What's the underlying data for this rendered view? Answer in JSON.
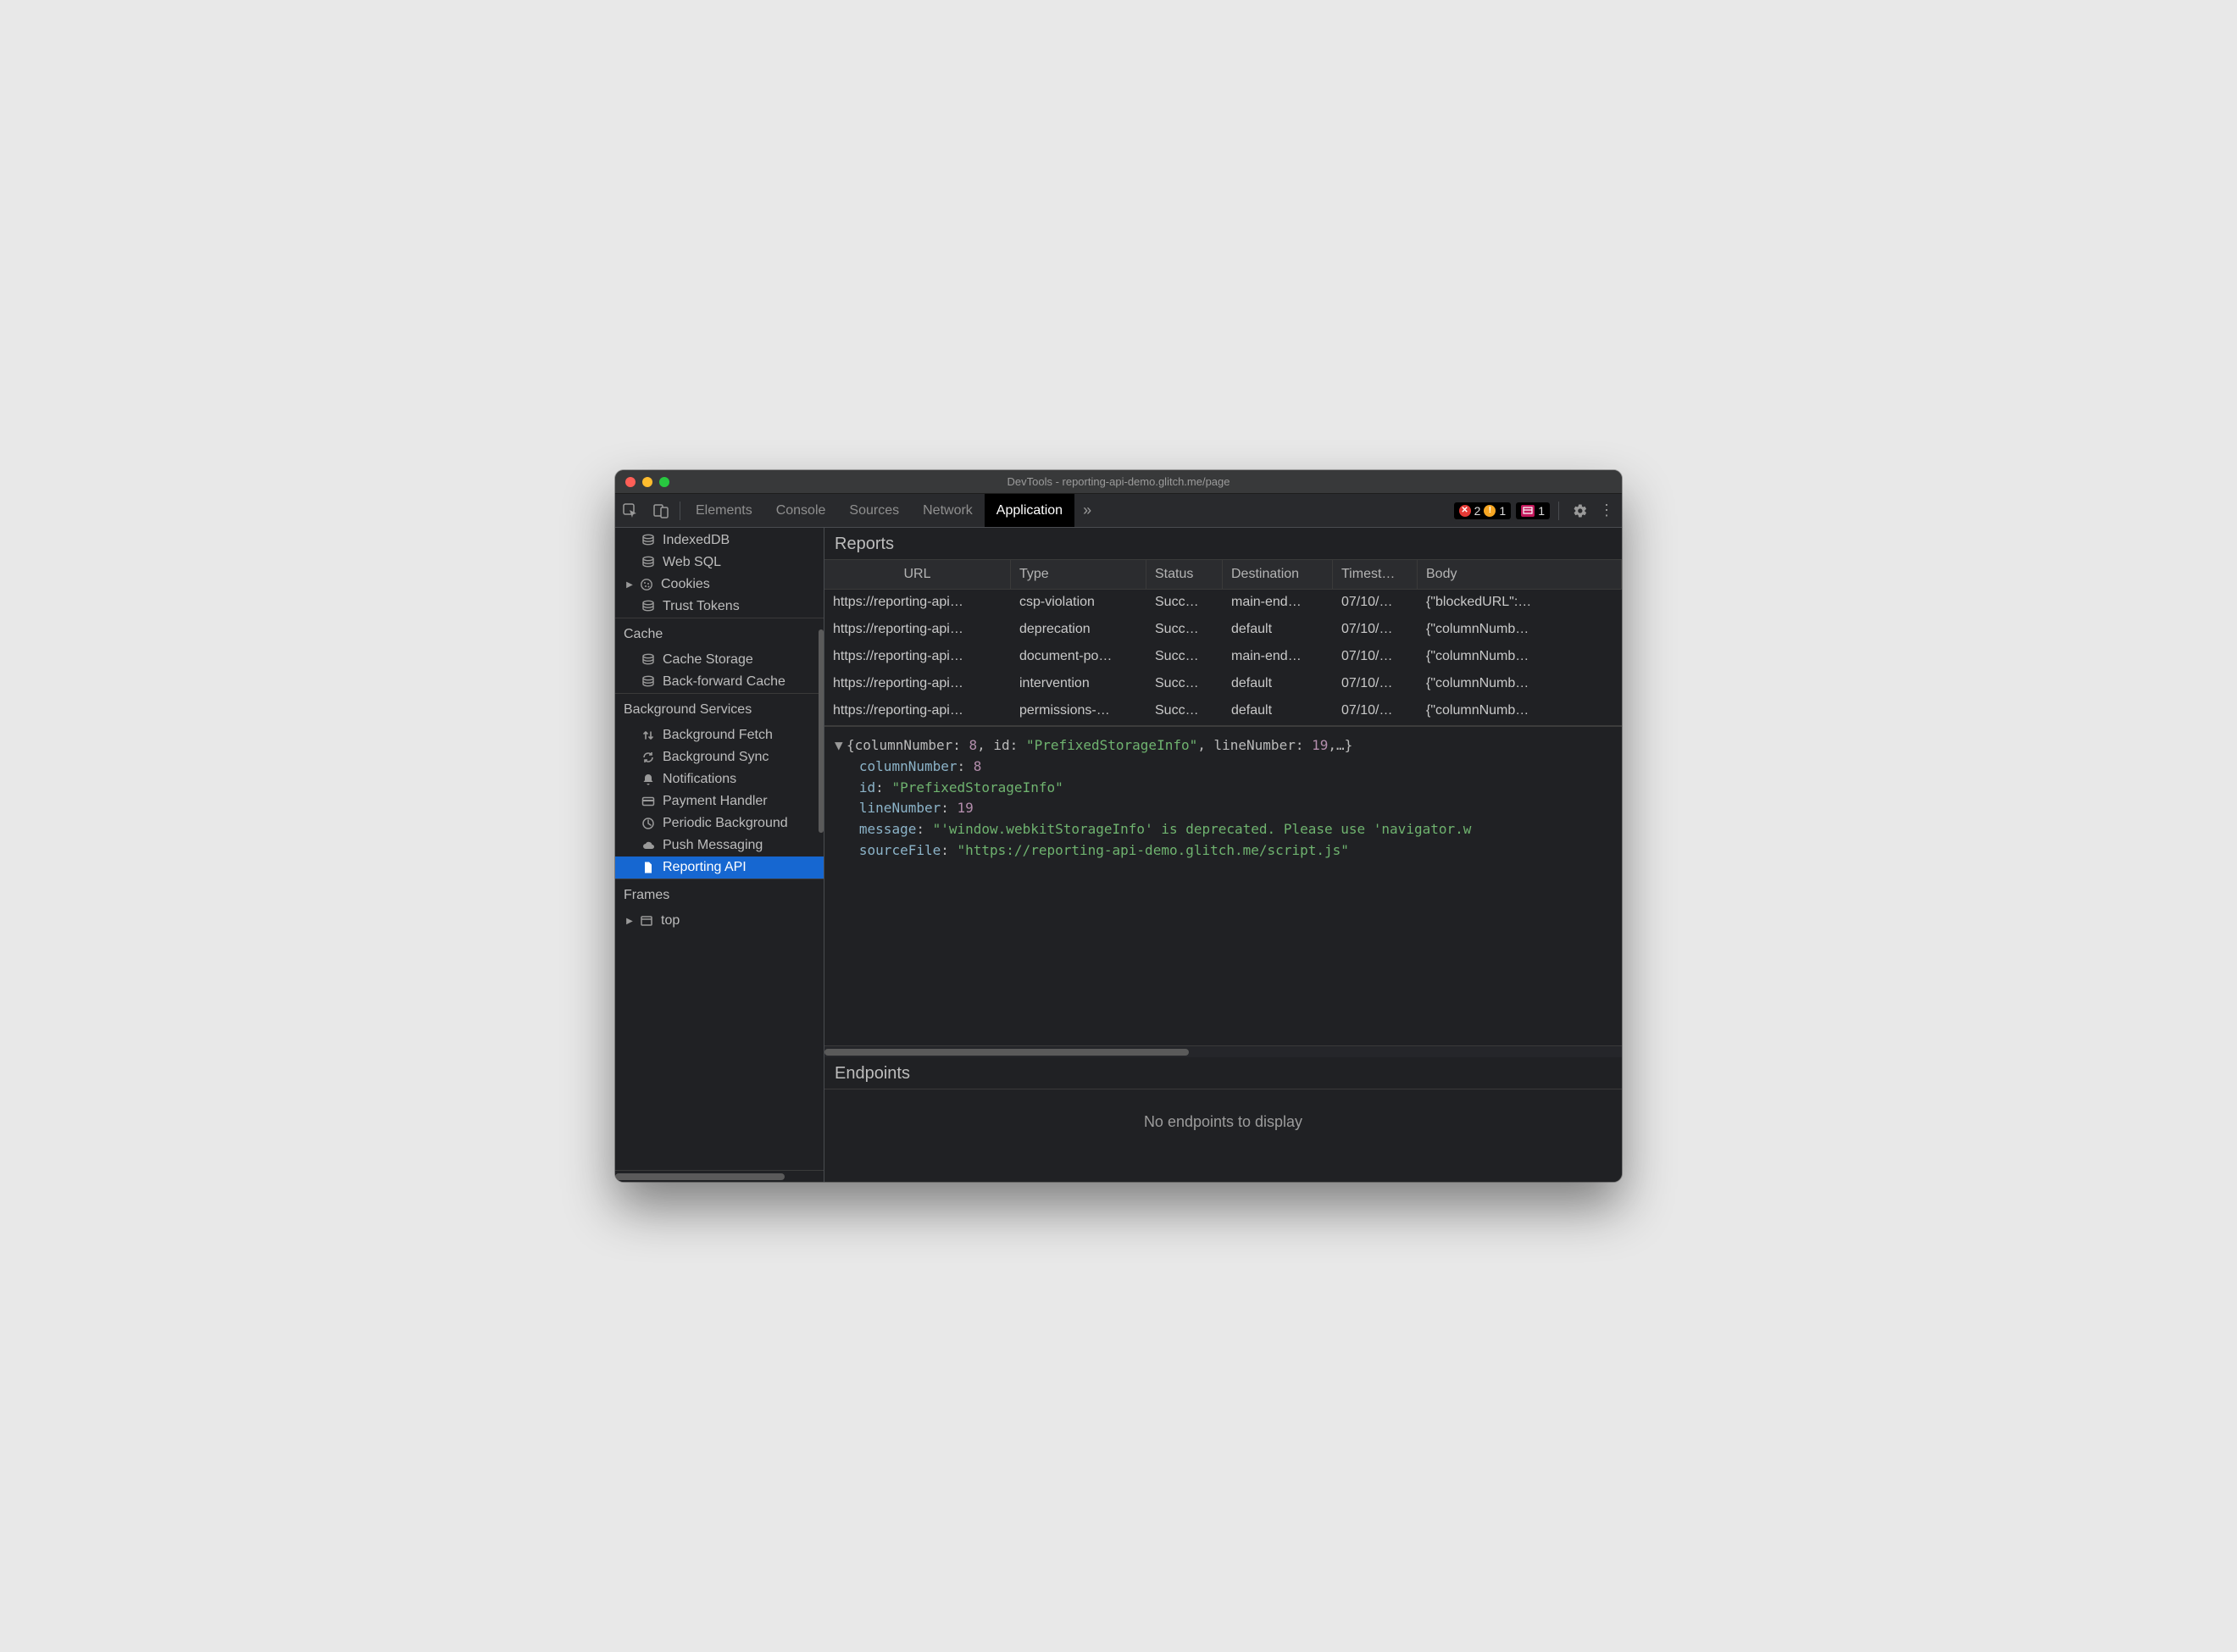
{
  "window": {
    "title": "DevTools - reporting-api-demo.glitch.me/page"
  },
  "toolbar": {
    "tabs": [
      "Elements",
      "Console",
      "Sources",
      "Network",
      "Application"
    ],
    "active_tab": "Application",
    "more": "»",
    "errors": "2",
    "warnings": "1",
    "issues": "1"
  },
  "sidebar": {
    "storage_items": [
      {
        "icon": "db",
        "label": "IndexedDB"
      },
      {
        "icon": "db",
        "label": "Web SQL"
      },
      {
        "icon": "cookie",
        "label": "Cookies",
        "expandable": true
      },
      {
        "icon": "db",
        "label": "Trust Tokens"
      }
    ],
    "cache_head": "Cache",
    "cache_items": [
      {
        "icon": "db",
        "label": "Cache Storage"
      },
      {
        "icon": "db",
        "label": "Back-forward Cache"
      }
    ],
    "bg_head": "Background Services",
    "bg_items": [
      {
        "icon": "updown",
        "label": "Background Fetch"
      },
      {
        "icon": "sync",
        "label": "Background Sync"
      },
      {
        "icon": "bell",
        "label": "Notifications"
      },
      {
        "icon": "card",
        "label": "Payment Handler"
      },
      {
        "icon": "clock",
        "label": "Periodic Background"
      },
      {
        "icon": "cloud",
        "label": "Push Messaging"
      },
      {
        "icon": "file",
        "label": "Reporting API",
        "selected": true
      }
    ],
    "frames_head": "Frames",
    "frames_items": [
      {
        "icon": "frame",
        "label": "top",
        "expandable": true
      }
    ]
  },
  "reports": {
    "title": "Reports",
    "columns": [
      "URL",
      "Type",
      "Status",
      "Destination",
      "Timest…",
      "Body"
    ],
    "rows": [
      {
        "url": "https://reporting-api…",
        "type": "csp-violation",
        "status": "Succ…",
        "dest": "main-end…",
        "ts": "07/10/…",
        "body": "{\"blockedURL\":…"
      },
      {
        "url": "https://reporting-api…",
        "type": "deprecation",
        "status": "Succ…",
        "dest": "default",
        "ts": "07/10/…",
        "body": "{\"columnNumb…"
      },
      {
        "url": "https://reporting-api…",
        "type": "document-po…",
        "status": "Succ…",
        "dest": "main-end…",
        "ts": "07/10/…",
        "body": "{\"columnNumb…"
      },
      {
        "url": "https://reporting-api…",
        "type": "intervention",
        "status": "Succ…",
        "dest": "default",
        "ts": "07/10/…",
        "body": "{\"columnNumb…"
      },
      {
        "url": "https://reporting-api…",
        "type": "permissions-…",
        "status": "Succ…",
        "dest": "default",
        "ts": "07/10/…",
        "body": "{\"columnNumb…"
      }
    ]
  },
  "detail": {
    "summary_prefix": "{columnNumber: ",
    "summary_col": "8",
    "summary_mid": ", id: ",
    "summary_id": "\"PrefixedStorageInfo\"",
    "summary_mid2": ", lineNumber: ",
    "summary_line": "19",
    "summary_suffix": ",…}",
    "k_columnNumber": "columnNumber",
    "v_columnNumber": "8",
    "k_id": "id",
    "v_id": "\"PrefixedStorageInfo\"",
    "k_lineNumber": "lineNumber",
    "v_lineNumber": "19",
    "k_message": "message",
    "v_message": "\"'window.webkitStorageInfo' is deprecated. Please use 'navigator.w",
    "k_sourceFile": "sourceFile",
    "v_sourceFile": "\"https://reporting-api-demo.glitch.me/script.js\""
  },
  "endpoints": {
    "title": "Endpoints",
    "empty": "No endpoints to display"
  }
}
